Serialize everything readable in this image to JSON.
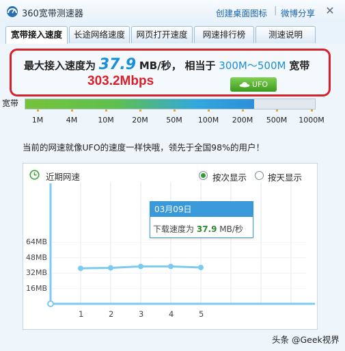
{
  "window": {
    "title": "360宽带测速器",
    "links": {
      "create_shortcut": "创建桌面图标",
      "separator": "|",
      "weibo_share": "微博分享"
    },
    "close_symbol": "✕"
  },
  "tabs": [
    {
      "label": "宽带接入速度",
      "active": true
    },
    {
      "label": "长途网络速度",
      "active": false
    },
    {
      "label": "网页打开速度",
      "active": false
    },
    {
      "label": "网速排行榜",
      "active": false
    },
    {
      "label": "测速说明",
      "active": false
    }
  ],
  "result": {
    "prefix": "最大接入速度为",
    "value": "37.9",
    "unit": "MB/秒，",
    "equiv": "相当于",
    "range": "300M～500M",
    "suffix": "宽带",
    "mbps": "303.2Mbps",
    "badge": "UFO"
  },
  "speed_bar": {
    "label": "宽带",
    "fill_fraction": 0.79,
    "scale": [
      "1M",
      "4M",
      "10M",
      "20M",
      "50M",
      "100M",
      "200M",
      "500M",
      "1000M"
    ]
  },
  "comparison_text": "当前的网速就像UFO的速度一样快哦，领先于全国98%的用户！",
  "history": {
    "title": "近期网速",
    "view_options": [
      {
        "label": "按次显示",
        "selected": true
      },
      {
        "label": "按天显示",
        "selected": false
      }
    ],
    "tooltip": {
      "date": "03月09日",
      "label": "下载速度为",
      "value": "37.9",
      "unit": "MB/秒"
    }
  },
  "chart_data": {
    "type": "line",
    "title": "近期网速",
    "xlabel": "",
    "ylabel": "",
    "x": [
      1,
      2,
      3,
      4,
      5
    ],
    "x_ticks": [
      "1",
      "2",
      "3",
      "4",
      "5"
    ],
    "y_ticks": [
      "16MB",
      "32MB",
      "48MB",
      "64MB"
    ],
    "ylim": [
      0,
      80
    ],
    "series": [
      {
        "values": [
          37.0,
          37.5,
          39.0,
          39.0,
          37.9
        ]
      }
    ],
    "grid": true,
    "colors": {
      "line": "#7dcaef",
      "axis": "#7dcaef",
      "point": "#7dcaef"
    }
  },
  "watermark": "头条 @Geek视界",
  "colors": {
    "accent": "#1a8ed8",
    "highlight_border": "#d8202b",
    "badge": "#4caf2a"
  }
}
